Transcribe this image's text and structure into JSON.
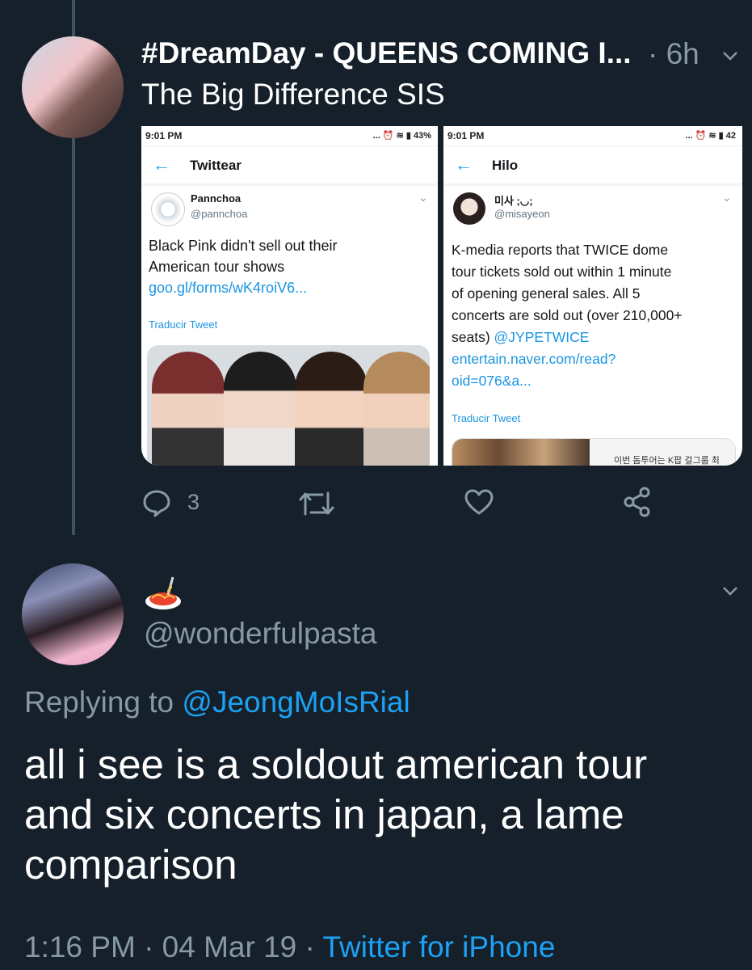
{
  "tweet1": {
    "display_name": "#DreamDay - QUEENS COMING I...",
    "time": "· 6h",
    "text": "The Big Difference SIS",
    "reply_count": "3"
  },
  "screenshot1": {
    "status_time": "9:01 PM",
    "status_icons": "... ⏰ ≋ ▮ 43%",
    "nav_title": "Twittear",
    "user_name": "Pannchoa",
    "user_handle": "@pannchoa",
    "text_line1": "Black Pink didn't sell out their",
    "text_line2": "American tour shows",
    "link": "goo.gl/forms/wK4roiV6...",
    "translate": "Traducir Tweet"
  },
  "screenshot2": {
    "status_time": "9:01 PM",
    "status_icons": "... ⏰ ≋ ▮ 42",
    "nav_title": "Hilo",
    "user_name": "미사 ;◡;",
    "user_handle": "@misayeon",
    "text_line1": "K-media reports that TWICE dome",
    "text_line2": "tour tickets sold out within 1 minute",
    "text_line3": "of opening general sales. All 5",
    "text_line4": "concerts are sold out (over 210,000+",
    "text_line5a": "seats) ",
    "mention": "@JYPETWICE",
    "link_line1": "entertain.naver.com/read?",
    "link_line2": "oid=076&a...",
    "translate": "Traducir Tweet",
    "photo_caption": "이번 돔투어는 K팝 걸그룹 최"
  },
  "tweet2": {
    "handle": "@wonderfulpasta",
    "replying_prefix": "Replying to ",
    "replying_mention": "@JeongMoIsRial",
    "line1": "all i see is a soldout american tour",
    "line2": "and six concerts in japan, a lame",
    "line3": "comparison",
    "footer_time": "1:16 PM · 04 Mar 19 · ",
    "footer_source": "Twitter for iPhone"
  },
  "colors": {
    "background": "#15202b",
    "secondary_text": "#8899a6",
    "accent": "#1da1f2"
  }
}
